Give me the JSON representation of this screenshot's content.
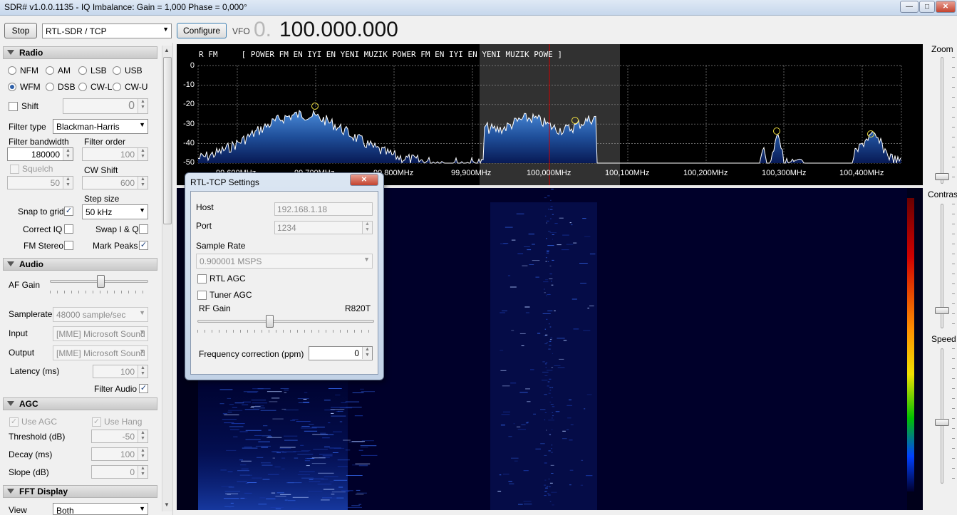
{
  "window": {
    "title": "SDR# v1.0.0.1135 - IQ Imbalance: Gain = 1,000 Phase = 0,000°",
    "controls": [
      "minimize",
      "maximize",
      "close"
    ]
  },
  "toolbar": {
    "stop_label": "Stop",
    "source_value": "RTL-SDR / TCP",
    "configure_label": "Configure",
    "vfo_label": "VFO",
    "vfo_prefix": "0.",
    "vfo_value": "100.000.000"
  },
  "radio": {
    "header": "Radio",
    "modes": [
      {
        "label": "NFM",
        "selected": false
      },
      {
        "label": "AM",
        "selected": false
      },
      {
        "label": "LSB",
        "selected": false
      },
      {
        "label": "USB",
        "selected": false
      },
      {
        "label": "WFM",
        "selected": true
      },
      {
        "label": "DSB",
        "selected": false
      },
      {
        "label": "CW-L",
        "selected": false
      },
      {
        "label": "CW-U",
        "selected": false
      }
    ],
    "shift_label": "Shift",
    "shift_value": "0",
    "filter_type_label": "Filter type",
    "filter_type_value": "Blackman-Harris",
    "filter_bandwidth_label": "Filter bandwidth",
    "filter_bandwidth_value": "180000",
    "filter_order_label": "Filter order",
    "filter_order_value": "100",
    "squelch_label": "Squelch",
    "squelch_value": "50",
    "cw_shift_label": "CW Shift",
    "cw_shift_value": "600",
    "step_size_label": "Step size",
    "step_size_value": "50 kHz",
    "snap_to_grid_label": "Snap to grid",
    "correct_iq_label": "Correct IQ",
    "swap_iq_label": "Swap I & Q",
    "fm_stereo_label": "FM Stereo",
    "mark_peaks_label": "Mark Peaks"
  },
  "audio": {
    "header": "Audio",
    "af_gain_label": "AF Gain",
    "samplerate_label": "Samplerate",
    "samplerate_value": "48000 sample/sec",
    "input_label": "Input",
    "input_value": "[MME] Microsoft Sound",
    "output_label": "Output",
    "output_value": "[MME] Microsoft Sound",
    "latency_label": "Latency (ms)",
    "latency_value": "100",
    "filter_audio_label": "Filter Audio"
  },
  "agc": {
    "header": "AGC",
    "use_agc_label": "Use AGC",
    "use_hang_label": "Use Hang",
    "threshold_label": "Threshold (dB)",
    "threshold_value": "-50",
    "decay_label": "Decay (ms)",
    "decay_value": "100",
    "slope_label": "Slope (dB)",
    "slope_value": "0"
  },
  "fft": {
    "header": "FFT Display",
    "view_label": "View",
    "view_value": "Both"
  },
  "spectrum": {
    "rds_text": "R FM     [ POWER FM EN IYI EN YENI MUZIK POWER FM EN IYI EN YENI MUZIK POWE ]",
    "y_labels": [
      "0",
      "-10",
      "-20",
      "-30",
      "-40",
      "-50"
    ],
    "freq_labels": [
      "99,600MHz",
      "99,700MHz",
      "99,800MHz",
      "99,900MHz",
      "100,000MHz",
      "100,100MHz",
      "100,200MHz",
      "100,300MHz",
      "100,400MHz"
    ]
  },
  "right_panel": {
    "zoom_label": "Zoom",
    "contrast_label": "Contrast",
    "speed_label": "Speed"
  },
  "dialog": {
    "title": "RTL-TCP Settings",
    "host_label": "Host",
    "host_value": "192.168.1.18",
    "port_label": "Port",
    "port_value": "1234",
    "sample_rate_label": "Sample Rate",
    "sample_rate_value": "0.900001 MSPS",
    "rtl_agc_label": "RTL AGC",
    "tuner_agc_label": "Tuner AGC",
    "rf_gain_label": "RF Gain",
    "tuner_name": "R820T",
    "freq_correction_label": "Frequency correction (ppm)",
    "freq_correction_value": "0",
    "close_glyph": "✕"
  },
  "colors": {
    "spectrum_fill": "#1f4f9a",
    "waterfall_bg": "#00001a",
    "vfo_marker": "#d00000",
    "peak_marker": "#f0e040"
  }
}
